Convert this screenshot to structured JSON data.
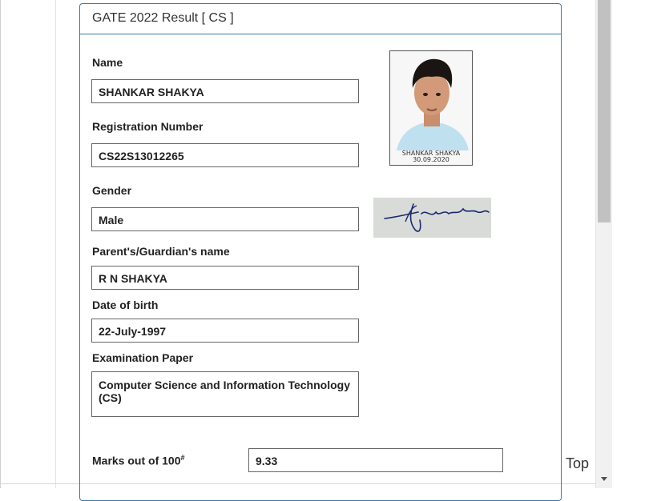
{
  "result": {
    "title": "GATE 2022 Result [ CS ]",
    "name_label": "Name",
    "name_value": "SHANKAR SHAKYA",
    "registration_label": "Registration Number",
    "registration_value": "CS22S13012265",
    "gender_label": "Gender",
    "gender_value": "Male",
    "guardian_label": "Parent's/Guardian's name",
    "guardian_value": "R N SHAKYA",
    "dob_label": "Date of birth",
    "dob_value": "22-July-1997",
    "paper_label": "Examination Paper",
    "paper_value": "Computer Science and Information Technology (CS)",
    "marks_label": "Marks out of 100",
    "marks_footnote_mark": "#",
    "marks_value": "9.33",
    "photo_caption_name": "SHANKAR SHAKYA",
    "photo_caption_date": "30.09.2020",
    "signature_text": "Shakya"
  },
  "top_link": "Top"
}
